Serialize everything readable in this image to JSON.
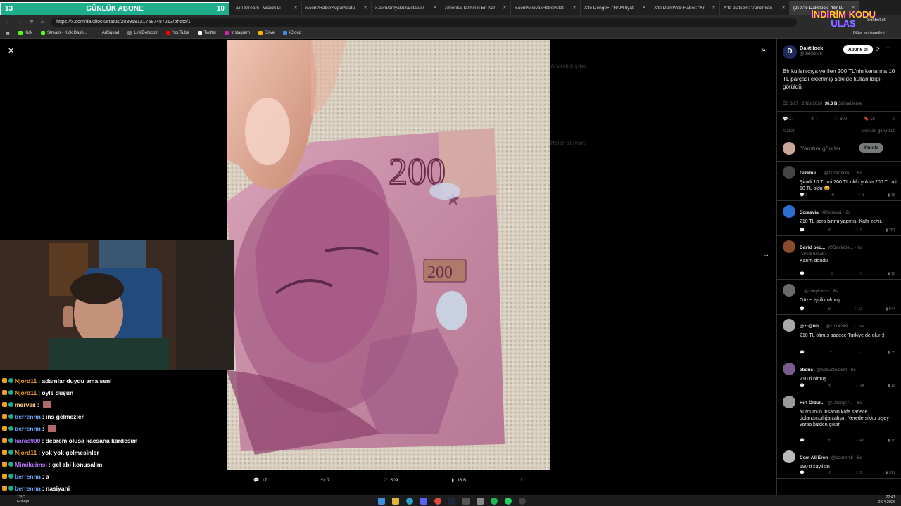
{
  "stream_bar": {
    "left": "13",
    "title": "GÜNLÜK ABONE",
    "right": "10"
  },
  "tabs": [
    {
      "label": "ajiri Stream - Watch Li"
    },
    {
      "label": "x.com/HaberKupur/statu"
    },
    {
      "label": "x.com/onlyakuza/status/"
    },
    {
      "label": "Amerika Tarihinin En Karı"
    },
    {
      "label": "x.com/MiovakHaber/stat"
    },
    {
      "label": "X'te Denge+: \"RAM fiyatl"
    },
    {
      "label": "X'te DarkWeb Haber: \"Kri"
    },
    {
      "label": "X'te platcom: \"Amerikan"
    },
    {
      "label": "(2) X'te Daktilock: \"Bir ku"
    }
  ],
  "address": {
    "url": "https://x.com/daktilock/status/2039681217587487213/photo/1"
  },
  "bookmarks": [
    "Kick",
    "Stream - Kick Dash...",
    "AdSquad",
    "LinkDetector",
    "YouTube",
    "Twitter",
    "Instagram",
    "Drive",
    "iCloud"
  ],
  "top_right": {
    "brand_line1": "İNDİRİM KODU",
    "brand_line2": "ULAS",
    "chat": "Sohbet et",
    "other_bookmarks": "Diğer yer işaretleri"
  },
  "viewer": {
    "close_icon": "close-icon",
    "expand_icon": "expand-icon",
    "next_icon": "chevron-right-icon",
    "photo": {
      "note_value": "200"
    },
    "ghost": {
      "heading": "Alakalı kişiler",
      "heading2": "Neler oluyor?"
    },
    "actions": {
      "replies": "17",
      "reposts": "7",
      "likes": "609",
      "views": "36 B"
    }
  },
  "panel": {
    "author_name": "Daktilock",
    "author_handle": "@daktilock",
    "follow_label": "Abone ol",
    "tweet_text": "Bir kullanıcıya verilen 200 TL'nin kenarına 10 TL parçası eklenmiş şekilde kullanıldığı görüldü.",
    "time": "ÖS 3:27 · 2 Nis 2026 · ",
    "views_count": "36,3 B",
    "views_label": " Görüntüleme",
    "stats": {
      "replies": "17",
      "reposts": "7",
      "likes": "609",
      "bookmarks": "16"
    },
    "sort_left": "Alakalı",
    "sort_right": "Alıntıları görüntüle",
    "reply_placeholder": "Yanıtını gönder",
    "reply_button": "Yanıtla",
    "replies": [
      {
        "name": "Gizemli ...",
        "handle": "@GizemliYo... · 6s",
        "text": "Şimdi 10 TL mi 200 TL oldu yoksa 200 TL mi 10 TL oldu 😄",
        "r": "1",
        "rt": "",
        "l": "3",
        "v": "18",
        "color": "#444"
      },
      {
        "name": "Screavia",
        "handle": "@Screvia · 2s",
        "text": "210 TL para birimi yapmış. Kafa zehir.",
        "r": "",
        "rt": "",
        "l": "1",
        "v": "281",
        "color": "#2a6fd1"
      },
      {
        "name": "David bec...",
        "handle": "@Davidbe... · 6s",
        "text": "Karım dondu",
        "sub": "Parodi hesabı",
        "r": "",
        "rt": "",
        "l": "",
        "v": "18",
        "color": "#8a4a2e"
      },
      {
        "name": ".",
        "handle": "@izleylclvss · 6s",
        "text": "Güzel işçilik olmuş",
        "r": "",
        "rt": "",
        "l": "12",
        "v": "944",
        "color": "#6a6a6a"
      },
      {
        "name": "@zr@llG...",
        "handle": "@zrl14249... · 1 sa",
        "text": "210 TL olmuş  sadece Turkiye de olur :)",
        "r": "",
        "rt": "",
        "l": "",
        "v": "35",
        "color": "#aaa"
      },
      {
        "name": "abduş",
        "handle": "@abdusfelaket · 6s",
        "text": "210 tl olmuş",
        "r": "",
        "rt": "",
        "l": "14",
        "v": "18",
        "color": "#7a5a8a"
      },
      {
        "name": "Hırt Öldür...",
        "handle": "@UTengl7... · 6s",
        "text": "Yurdumun İnsanın kafa sadece dolandıncılığa çalışır. Nerede sikko bişey varsa bizden çıkar",
        "r": "",
        "rt": "",
        "l": "41",
        "v": "18",
        "color": "#999"
      },
      {
        "name": "Cem Ali Eren",
        "handle": "@caerenjk · 6s",
        "text": "190 tl sayılsın",
        "r": "",
        "rt": "",
        "l": "1",
        "v": "917",
        "color": "#bbb"
      }
    ]
  },
  "chat": [
    {
      "user": "Njord11",
      "msg": " : adamlar duydu ama seni",
      "color": "#f0a020"
    },
    {
      "user": "Njord11",
      "msg": " : öyle düşün",
      "color": "#f0a020"
    },
    {
      "user": "merveii",
      "msg": " :",
      "color": "#ffd080",
      "emote": true
    },
    {
      "user": "berrennn",
      "msg": " : ins gelmezler",
      "color": "#6fa8ff"
    },
    {
      "user": "berrennn",
      "msg": " :",
      "color": "#6fa8ff",
      "emote": true
    },
    {
      "user": "karas990",
      "msg": " : deprem olusa kacsana kardesim",
      "color": "#b077ff"
    },
    {
      "user": "Njord11",
      "msg": " : yok yok gelmesinler",
      "color": "#f0a020"
    },
    {
      "user": "Mimikcimsi",
      "msg": " : gel abi konusalim",
      "color": "#c07aff"
    },
    {
      "user": "berrennn",
      "msg": " : a",
      "color": "#6fa8ff"
    },
    {
      "user": "berrennn",
      "msg": " : nasiyani",
      "color": "#6fa8ff"
    },
    {
      "user": "muhden",
      "msg": " : gogllvlvvo",
      "color": "#fff"
    }
  ],
  "taskbar": {
    "weather_temp": "13°C",
    "weather_desc": "Güneşli",
    "time": "22:41",
    "date": "2.04.2026"
  }
}
